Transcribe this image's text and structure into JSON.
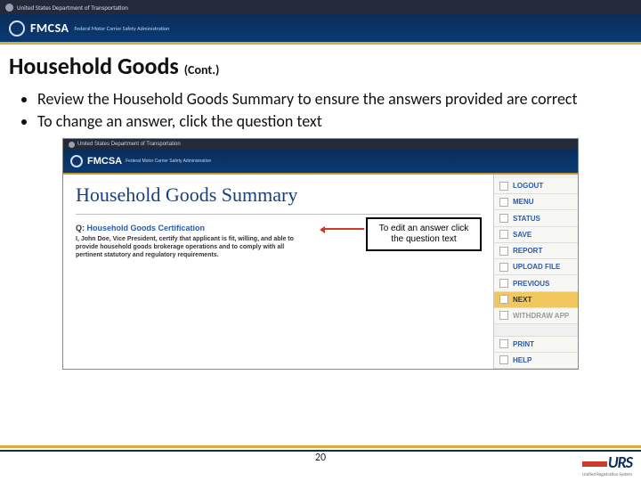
{
  "gov_bar": {
    "text": "United States Department of Transportation"
  },
  "fmcsa_bar": {
    "brand": "FMCSA",
    "sub": "Federal Motor Carrier Safety Administration"
  },
  "title": {
    "main": "Household Goods",
    "cont": "(Cont.)"
  },
  "bullets": [
    "Review the Household Goods Summary to ensure the answers provided are correct",
    "To change an answer, click the question text"
  ],
  "screenshot": {
    "gov_text": "United States Department of Transportation",
    "brand": "FMCSA",
    "sub": "Federal Motor Carrier Safety Administration",
    "heading": "Household Goods Summary",
    "q_prefix": "Q:",
    "q_link": "Household Goods Certification",
    "q_body": "I, John Doe, Vice President, certify that applicant is fit, willing, and able to provide household goods brokerage operations and to comply with all pertinent statutory and regulatory requirements.",
    "sidebar": [
      {
        "label": "LOGOUT",
        "icon": "logout-icon"
      },
      {
        "label": "MENU",
        "icon": "menu-icon"
      },
      {
        "label": "STATUS",
        "icon": "status-icon"
      },
      {
        "label": "SAVE",
        "icon": "save-icon"
      },
      {
        "label": "REPORT",
        "icon": "report-icon"
      },
      {
        "label": "UPLOAD FILE",
        "icon": "upload-icon"
      },
      {
        "label": "PREVIOUS",
        "icon": "previous-icon"
      },
      {
        "label": "NEXT",
        "icon": "next-icon",
        "active": true
      },
      {
        "label": "WITHDRAW APP",
        "icon": "withdraw-icon",
        "muted": true
      },
      {
        "label": "PRINT",
        "icon": "print-icon"
      },
      {
        "label": "HELP",
        "icon": "help-icon"
      }
    ]
  },
  "callout": "To edit an answer click the question text",
  "page_number": "20",
  "urs": {
    "logo": "URS",
    "tag": "Unified Registration System"
  }
}
